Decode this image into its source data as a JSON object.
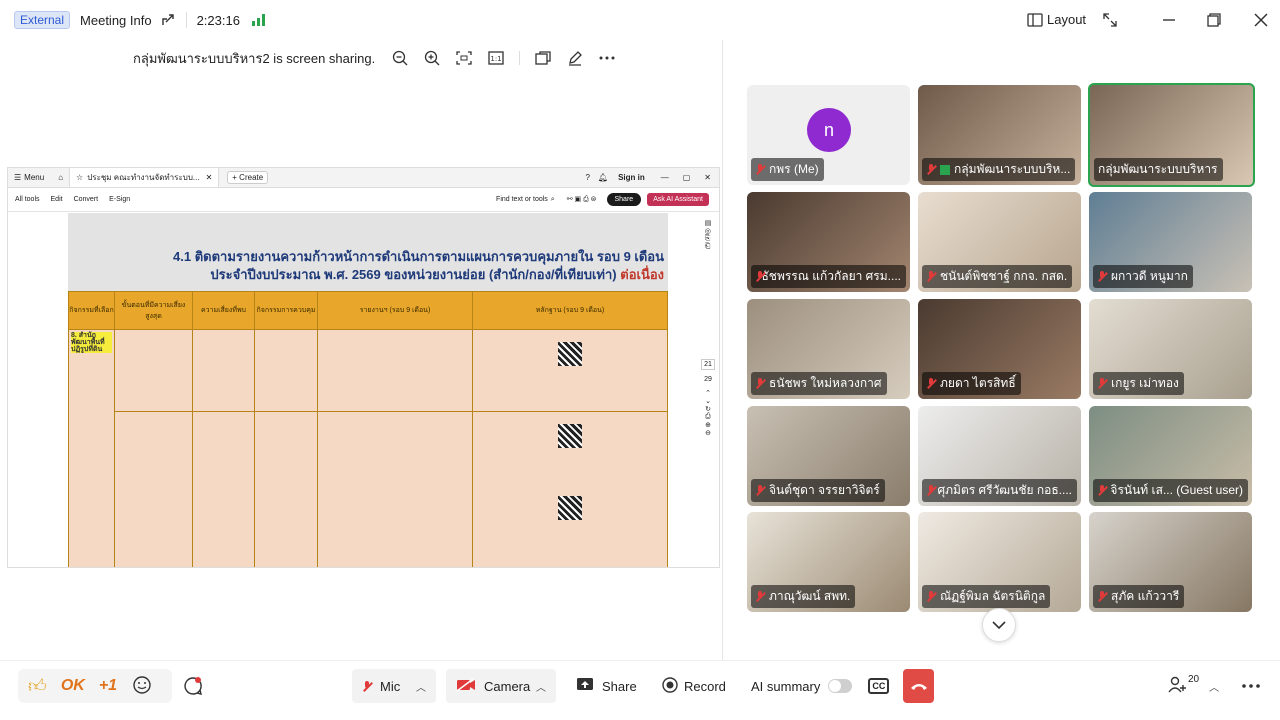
{
  "topbar": {
    "badge": "External",
    "meeting_info": "Meeting Info",
    "timer": "2:23:16",
    "layout_label": "Layout"
  },
  "share_header": {
    "text": "กลุ่มพัฒนาระบบบริหาร2 is screen sharing."
  },
  "pdf": {
    "tab_label": "ประชุม คณะทำงานจัดทำระบบ...",
    "create_label": "+ Create",
    "signin_label": "Sign in",
    "menu_label": "Menu",
    "tools": [
      "All tools",
      "Edit",
      "Convert",
      "E-Sign"
    ],
    "find_label": "Find text or tools",
    "share_label": "Share",
    "ask_ai_label": "Ask AI Assistant",
    "title_line1": "4.1 ติดตามรายงานความก้าวหน้าการดำเนินการตามแผนการควบคุมภายใน รอบ 9 เดือน",
    "title_line2_main": "ประจำปีงบประมาณ พ.ศ. 2569 ของหน่วยงานย่อย (สำนัก/กอง/ที่เทียบเท่า)",
    "title_line2_accent": "ต่อเนื่อง",
    "headers": [
      "กิจกรรมที่เลือก",
      "ขั้นตอนที่มีความเสี่ยงสูงสุด",
      "ความเสี่ยงที่พบ",
      "กิจกรรมการควบคุม",
      "รายงานฯ (รอบ 9 เดือน)",
      "หลักฐาน (รอบ 9 เดือน)"
    ],
    "unit_label": "8. สำนักพัฒนาพื้นที่ปฏิรูปที่ดิน",
    "page_current": "21",
    "page_total": "29"
  },
  "participants": [
    {
      "name": "กพร (Me)",
      "avatar": "n"
    },
    {
      "name": "กลุ่มพัฒนาระบบบริห..."
    },
    {
      "name": "กลุ่มพัฒนาระบบบริหาร"
    },
    {
      "name": "ธัชพรรณ แก้วกัลยา ศรม...."
    },
    {
      "name": "ชนันต์พิชชาฐ์ กกจ. กสด."
    },
    {
      "name": "ผกาวดี หนูมาก"
    },
    {
      "name": "ธนัชพร ใหม่หลวงกาศ"
    },
    {
      "name": "ภยดา ไตรสิทธิ์"
    },
    {
      "name": "เกยูร เม่าทอง"
    },
    {
      "name": "จินต์ชุดา จรรยาวิจิตร์"
    },
    {
      "name": "ศุภมิตร ศรีวัฒนชัย กอธ...."
    },
    {
      "name": "จิรนันท์ เส... (Guest user)"
    },
    {
      "name": "ภาณุวัฒน์ สพท."
    },
    {
      "name": "ณัฏฐ์พิมล ฉัตรนิติกูล"
    },
    {
      "name": "สุภัค แก้ววารี"
    }
  ],
  "bottombar": {
    "ok_label": "OK",
    "plus1_label": "+1",
    "mic_label": "Mic",
    "camera_label": "Camera",
    "share_label": "Share",
    "record_label": "Record",
    "ai_summary_label": "AI summary",
    "cc_label": "CC",
    "participant_count": "20"
  },
  "colors": {
    "end_call": "#e14b45",
    "accent_green": "#2aa44f",
    "muted_red": "#e03a3a",
    "table_header": "#e8a72a"
  }
}
